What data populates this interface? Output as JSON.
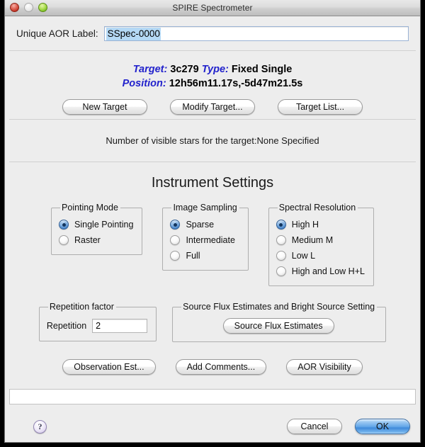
{
  "window": {
    "title": "SPIRE Spectrometer",
    "traffic_lights": [
      "close-button",
      "minimize-button",
      "zoom-button"
    ]
  },
  "aor": {
    "label": "Unique AOR Label:",
    "value": "SSpec-0000",
    "placeholder": ""
  },
  "target": {
    "target_key": "Target:",
    "target_value": "3c279",
    "type_key": "Type:",
    "type_value": "Fixed Single",
    "position_key": "Position:",
    "position_value": "12h56m11.17s,-5d47m21.5s",
    "buttons": [
      {
        "label": "New Target",
        "name": "new-target-button"
      },
      {
        "label": "Modify Target...",
        "name": "modify-target-button"
      },
      {
        "label": "Target List...",
        "name": "target-list-button"
      }
    ]
  },
  "visible_stars": {
    "text": "Number of visible stars for the target:None Specified"
  },
  "instrument": {
    "heading": "Instrument Settings",
    "pointing_mode": {
      "legend": "Pointing Mode",
      "options": [
        {
          "label": "Single Pointing",
          "selected": true
        },
        {
          "label": "Raster",
          "selected": false
        }
      ]
    },
    "image_sampling": {
      "legend": "Image Sampling",
      "options": [
        {
          "label": "Sparse",
          "selected": true
        },
        {
          "label": "Intermediate",
          "selected": false
        },
        {
          "label": "Full",
          "selected": false
        }
      ]
    },
    "spectral_resolution": {
      "legend": "Spectral Resolution",
      "options": [
        {
          "label": "High H",
          "selected": true
        },
        {
          "label": "Medium M",
          "selected": false
        },
        {
          "label": "Low L",
          "selected": false
        },
        {
          "label": "High and Low H+L",
          "selected": false
        }
      ]
    }
  },
  "repetition": {
    "legend": "Repetition factor",
    "label": "Repetition",
    "value": "2"
  },
  "source_flux": {
    "legend": "Source Flux Estimates and Bright Source Setting",
    "button_label": "Source Flux Estimates"
  },
  "bottom_buttons": [
    {
      "label": "Observation Est...",
      "name": "observation-est-button"
    },
    {
      "label": "Add Comments...",
      "name": "add-comments-button"
    },
    {
      "label": "AOR Visibility",
      "name": "aor-visibility-button"
    }
  ],
  "status_bar": {
    "text": ""
  },
  "footer": {
    "help_label": "?",
    "cancel_label": "Cancel",
    "ok_label": "OK"
  },
  "colors": {
    "window_bg": "#ededed",
    "accent_blue": "#2222cc",
    "default_button_blue": "#3f8ada",
    "selection_highlight": "#b5d9f5",
    "radio_selected": "#4a86ca"
  }
}
